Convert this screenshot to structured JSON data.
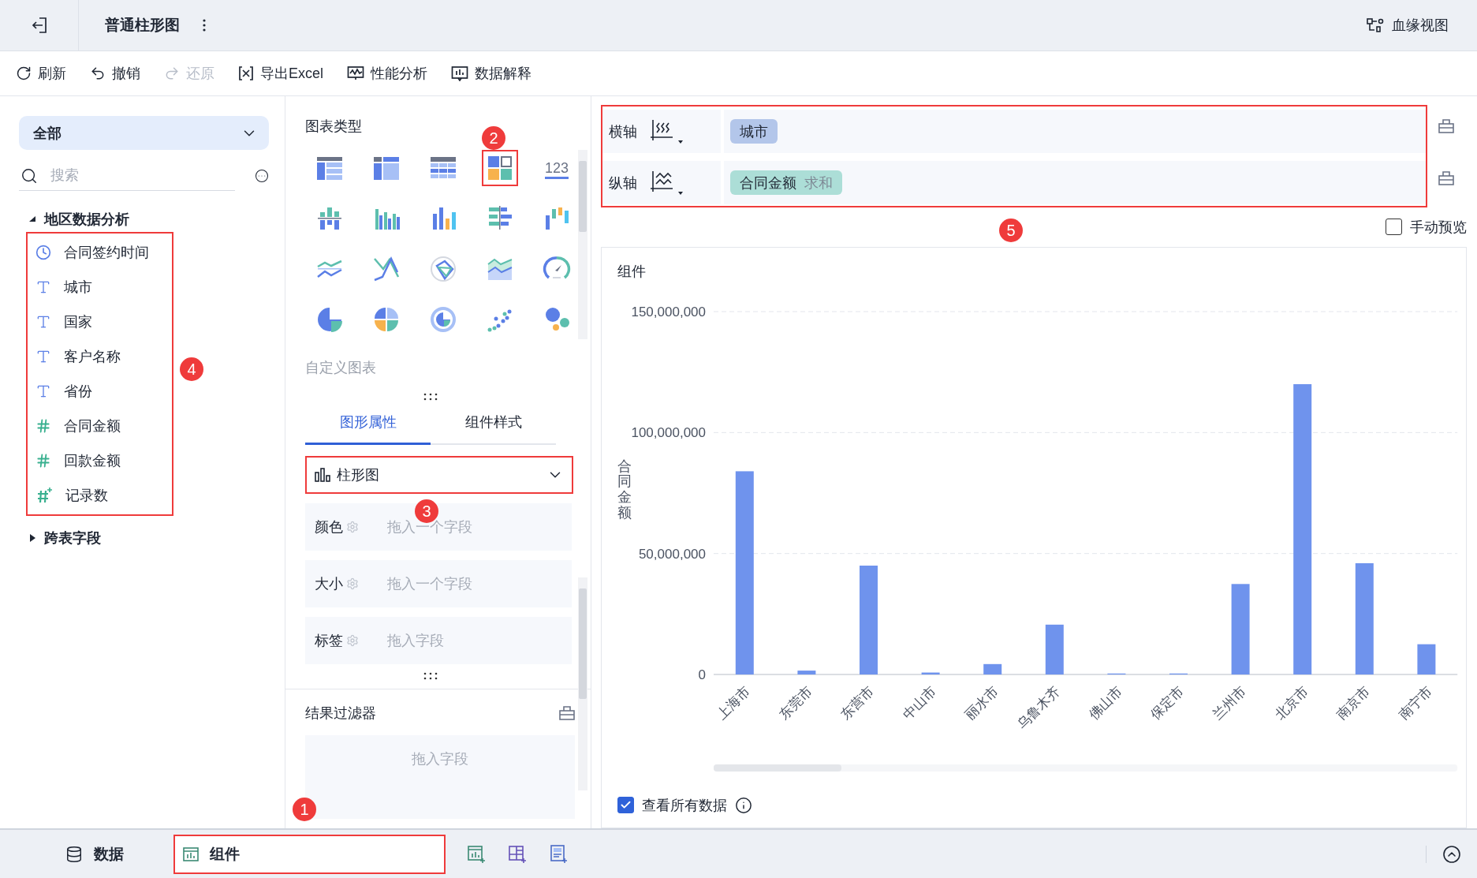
{
  "header": {
    "title": "普通柱形图",
    "lineage_link": "血缘视图"
  },
  "toolbar": [
    {
      "kind": "refresh",
      "label": "刷新",
      "disabled": false
    },
    {
      "kind": "undo",
      "label": "撤销",
      "disabled": false
    },
    {
      "kind": "redo",
      "label": "还原",
      "disabled": true
    },
    {
      "kind": "export",
      "label": "导出Excel",
      "disabled": false
    },
    {
      "kind": "performance",
      "label": "性能分析",
      "disabled": false
    },
    {
      "kind": "explain",
      "label": "数据解释",
      "disabled": false
    }
  ],
  "data_panel": {
    "scope": "全部",
    "search_placeholder": "搜索",
    "tree": [
      {
        "label": "地区数据分析",
        "expanded": true,
        "highlighted": true,
        "children": [
          {
            "kind": "time",
            "label": "合同签约时间"
          },
          {
            "kind": "text",
            "label": "城市"
          },
          {
            "kind": "text",
            "label": "国家"
          },
          {
            "kind": "text",
            "label": "客户名称"
          },
          {
            "kind": "text",
            "label": "省份"
          },
          {
            "kind": "number",
            "label": "合同金额"
          },
          {
            "kind": "number",
            "label": "回款金额"
          },
          {
            "kind": "count",
            "label": "记录数"
          }
        ]
      },
      {
        "label": "跨表字段",
        "expanded": false
      }
    ]
  },
  "chart_panel": {
    "title": "图表类型",
    "chart_types": [
      {
        "kind": "group-table",
        "selected": false
      },
      {
        "kind": "cross-table",
        "selected": false
      },
      {
        "kind": "detail-table",
        "selected": false
      },
      {
        "kind": "dashboard",
        "selected": true
      },
      {
        "kind": "kpi",
        "label": "123",
        "selected": false
      },
      {
        "kind": "stacked-bar",
        "selected": false
      },
      {
        "kind": "multi-bar",
        "selected": false
      },
      {
        "kind": "bar",
        "selected": false
      },
      {
        "kind": "horizontal-bar",
        "selected": false
      },
      {
        "kind": "waterfall",
        "selected": false
      },
      {
        "kind": "line",
        "selected": false
      },
      {
        "kind": "cross-line",
        "selected": false
      },
      {
        "kind": "radar",
        "selected": false
      },
      {
        "kind": "area",
        "selected": false
      },
      {
        "kind": "gauge",
        "selected": false
      },
      {
        "kind": "pie",
        "selected": false
      },
      {
        "kind": "multi-pie",
        "selected": false
      },
      {
        "kind": "ring",
        "selected": false
      },
      {
        "kind": "scatter",
        "selected": false
      },
      {
        "kind": "bubble",
        "selected": false
      }
    ],
    "custom_chart": "自定义图表",
    "tabs": [
      {
        "label": "图形属性",
        "selected": true
      },
      {
        "label": "组件样式",
        "selected": false
      }
    ],
    "chart_select": {
      "value": "柱形图",
      "highlighted": true
    },
    "properties": [
      {
        "label": "颜色",
        "placeholder": "拖入一个字段"
      },
      {
        "label": "大小",
        "placeholder": "拖入一个字段"
      },
      {
        "label": "标签",
        "placeholder": "拖入字段"
      }
    ],
    "filter": {
      "title": "结果过滤器",
      "placeholder": "拖入字段"
    }
  },
  "axes": {
    "highlighted": true,
    "rows": [
      {
        "label": "横轴",
        "field": "城市",
        "color": "#b3c6ea"
      },
      {
        "label": "纵轴",
        "field": "合同金额",
        "aggregation": "求和",
        "color": "#acded7"
      }
    ]
  },
  "manual_preview": {
    "label": "手动预览",
    "checked": false
  },
  "component": {
    "title": "组件",
    "chart_data": {
      "type": "bar",
      "ylabel": "合同金额",
      "categories": [
        "上海市",
        "东莞市",
        "东营市",
        "中山市",
        "丽水市",
        "乌鲁木齐",
        "佛山市",
        "保定市",
        "兰州市",
        "北京市",
        "南京市",
        "南宁市"
      ],
      "series": [
        {
          "color": "#6f93ed",
          "values": [
            84000000,
            1600000,
            45000000,
            800000,
            4300000,
            20600000,
            400000,
            400000,
            37400000,
            120000000,
            46000000,
            12500000
          ]
        }
      ],
      "ylim": [
        0,
        150000000
      ],
      "yticks": [
        {
          "value": 0,
          "label": "0"
        },
        {
          "value": 50000000,
          "label": "50,000,000"
        },
        {
          "value": 100000000,
          "label": "100,000,000"
        },
        {
          "value": 150000000,
          "label": "150,000,000"
        }
      ]
    },
    "view_all": {
      "label": "查看所有数据",
      "checked": true
    }
  },
  "bottom_tabs": [
    {
      "kind": "data",
      "label": "数据",
      "selected": false
    },
    {
      "kind": "component",
      "label": "组件",
      "selected": true,
      "highlighted": true
    }
  ],
  "annotations": [
    {
      "number": "1"
    },
    {
      "number": "2"
    },
    {
      "number": "3"
    },
    {
      "number": "4"
    },
    {
      "number": "5"
    }
  ]
}
